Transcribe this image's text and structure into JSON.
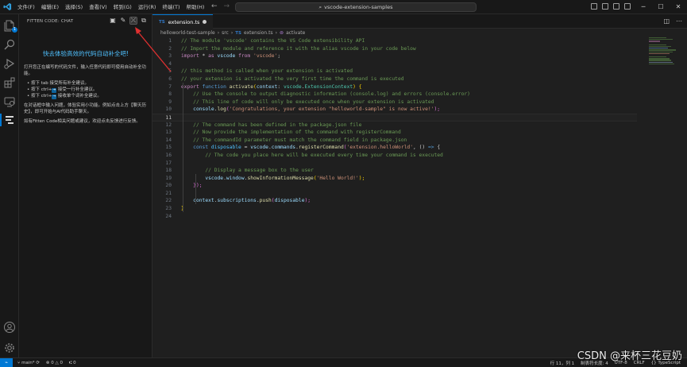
{
  "titlebar": {
    "menus": [
      "文件(F)",
      "编辑(E)",
      "选择(S)",
      "查看(V)",
      "转到(G)",
      "运行(R)",
      "终端(T)",
      "帮助(H)"
    ],
    "search_text": "vscode-extension-samples"
  },
  "activity_bar": {
    "icons": [
      "explorer-icon",
      "search-icon",
      "run-debug-icon",
      "extensions-icon",
      "remote-explorer-icon",
      "fitten-code-icon",
      "account-icon",
      "settings-gear-icon"
    ],
    "explorer_badge": "1"
  },
  "sidebar": {
    "header": "FITTEN CODE: CHAT",
    "title": "快去体验高效的代码自动补全吧!",
    "intro": "打开您正在编写的代码文件，输入任意代码即可使用自动补全功能。",
    "bullets": [
      {
        "before": "按下 tab 接受所有补全建议。",
        "key": "",
        "after": ""
      },
      {
        "before": "按下 ctrl+",
        "key": "⇥",
        "after": "接受一行补全建议。"
      },
      {
        "before": "按下 ctrl+",
        "key": "→",
        "after": "接收单个词补全建议。"
      }
    ],
    "tip1": "在对话框中输入问题，体验实用小功能。例如点击上方【聊天历史】，即可开始与AI代码助手聊天。",
    "tip2": "如有Fitten Code相关问题或建议，欢迎点击反馈进行反馈。"
  },
  "editor": {
    "tab": {
      "lang": "TS",
      "name": "extension.ts"
    },
    "breadcrumb": [
      "helloworld-test-sample",
      "src",
      "extension.ts",
      "activate"
    ],
    "breadcrumb_lang": "TS",
    "current_line": 11,
    "line_numbers": [
      "1",
      "2",
      "3",
      "4",
      "5",
      "6",
      "7",
      "8",
      "9",
      "10",
      "11",
      "12",
      "13",
      "14",
      "15",
      "16",
      "17",
      "18",
      "19",
      "20",
      "21",
      "22",
      "23",
      "24"
    ],
    "code": {
      "l1": "// The module 'vscode' contains the VS Code extensibility API",
      "l2": "// Import the module and reference it with the alias vscode in your code below",
      "l3_a": "import",
      "l3_b": " * ",
      "l3_c": "as",
      "l3_d": " vscode ",
      "l3_e": "from",
      "l3_f": "'vscode'",
      "l3_g": ";",
      "l5": "// this method is called when your extension is activated",
      "l6": "// your extension is activated the very first time the command is executed",
      "l7_a": "export",
      "l7_b": " function ",
      "l7_c": "activate",
      "l7_d": "(",
      "l7_e": "context",
      "l7_f": ": ",
      "l7_g": "vscode",
      "l7_h": ".",
      "l7_i": "ExtensionContext",
      "l7_j": ") {",
      "l8": "// Use the console to output diagnostic information (console.log) and errors (console.error)",
      "l9": "// This line of code will only be executed once when your extension is activated",
      "l10_a": "console",
      "l10_b": ".",
      "l10_c": "log",
      "l10_d": "(",
      "l10_e": "'Congratulations, your extension \"helloworld-sample\" is now active!'",
      "l10_f": ");",
      "l12": "// The command has been defined in the package.json file",
      "l13": "// Now provide the implementation of the command with registerCommand",
      "l14": "// The commandId parameter must match the command field in package.json",
      "l15_a": "const",
      "l15_b": " disposable",
      "l15_c": " = ",
      "l15_d": "vscode",
      "l15_e": ".",
      "l15_f": "commands",
      "l15_g": ".",
      "l15_h": "registerCommand",
      "l15_i": "(",
      "l15_j": "'extension.helloWorld'",
      "l15_k": ", () ",
      "l15_l": "=>",
      "l15_m": " {",
      "l16": "// The code you place here will be executed every time your command is executed",
      "l18": "// Display a message box to the user",
      "l19_a": "vscode",
      "l19_b": ".",
      "l19_c": "window",
      "l19_d": ".",
      "l19_e": "showInformationMessage",
      "l19_f": "(",
      "l19_g": "'Hello World!'",
      "l19_h": ");",
      "l20": "});",
      "l22_a": "context",
      "l22_b": ".",
      "l22_c": "subscriptions",
      "l22_d": ".",
      "l22_e": "push",
      "l22_f": "(",
      "l22_g": "disposable",
      "l22_h": ");",
      "l23": "}"
    }
  },
  "statusbar": {
    "branch": "main*",
    "errors": "0",
    "warnings": "0",
    "ports": "0",
    "cursor": "行 11，列 1",
    "tab_size": "制表符长度: 4",
    "encoding": "UTF-8",
    "eol": "CRLF",
    "language": "{} TypeScript"
  },
  "watermark": "CSDN @来杯三花豆奶",
  "colors": {
    "accent": "#0078d4",
    "arrow": "#e03030",
    "title": "#4fc1ff"
  }
}
